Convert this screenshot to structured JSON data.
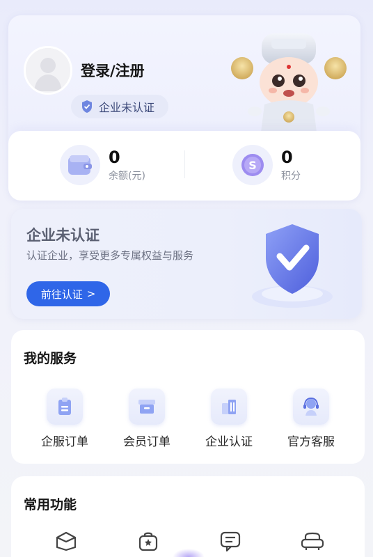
{
  "profile": {
    "login_label": "登录/注册",
    "cert_status": "企业未认证",
    "balance": {
      "value": "0",
      "label": "余额(元)"
    },
    "points": {
      "value": "0",
      "label": "积分"
    }
  },
  "enterprise": {
    "title": "企业未认证",
    "subtitle": "认证企业，享受更多专属权益与服务",
    "button_label": "前往认证",
    "button_arrow": ">"
  },
  "services": {
    "title": "我的服务",
    "items": [
      {
        "label": "企服订单",
        "icon": "clipboard-icon"
      },
      {
        "label": "会员订单",
        "icon": "box-icon"
      },
      {
        "label": "企业认证",
        "icon": "building-icon"
      },
      {
        "label": "官方客服",
        "icon": "headset-icon"
      }
    ]
  },
  "functions": {
    "title": "常用功能",
    "items": [
      {
        "icon": "package-icon"
      },
      {
        "icon": "bag-icon"
      },
      {
        "icon": "chat-icon"
      },
      {
        "icon": "sofa-icon"
      }
    ]
  },
  "colors": {
    "accent": "#2f66e8",
    "shield": "#6a78e8",
    "text": "#161616"
  }
}
